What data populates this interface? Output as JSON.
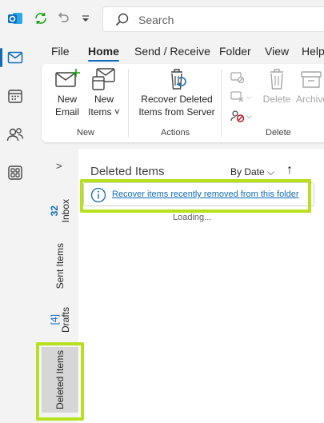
{
  "titlebar": {
    "search_placeholder": "Search"
  },
  "tabs": [
    {
      "label": "File"
    },
    {
      "label": "Home"
    },
    {
      "label": "Send / Receive"
    },
    {
      "label": "Folder"
    },
    {
      "label": "View"
    },
    {
      "label": "Help"
    }
  ],
  "ribbon": {
    "new_email": "New\nEmail",
    "new_items": "New\nItems ˅",
    "group_new": "New",
    "recover": "Recover Deleted\nItems from Server",
    "group_actions": "Actions",
    "delete": "Delete",
    "archive": "Archive",
    "group_delete": "Delete"
  },
  "folders": {
    "inbox": {
      "label": "Inbox",
      "count": "32"
    },
    "sent": {
      "label": "Sent Items"
    },
    "drafts": {
      "label": "Drafts",
      "count": "[4]"
    },
    "deleted": {
      "label": "Deleted Items"
    }
  },
  "list": {
    "title": "Deleted Items",
    "sort_label": "By Date ⌵",
    "sort_dir": "↑",
    "info_link": "Recover items recently removed from this folder",
    "loading": "Loading..."
  },
  "colors": {
    "accent": "#0f6cbd",
    "highlight": "#b8e01e"
  }
}
